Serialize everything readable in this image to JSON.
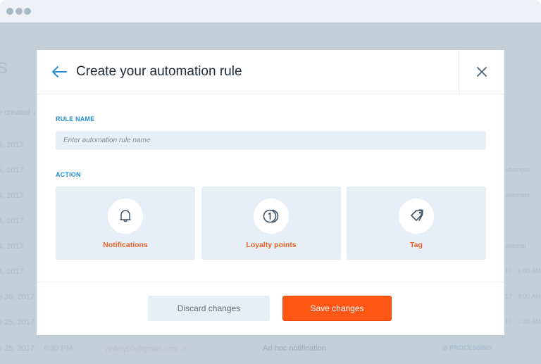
{
  "window": {
    "controls": [
      "close-dot",
      "minimize-dot",
      "maximize-dot"
    ]
  },
  "background": {
    "heading": "S",
    "column_header": "e created  ↓",
    "rows": [
      {
        "date": "5, 2017",
        "right": ""
      },
      {
        "date": "5, 2017",
        "right": "attempts"
      },
      {
        "date": "4, 2017",
        "right": "attempts"
      },
      {
        "date": "4, 2017",
        "right": ""
      },
      {
        "date": "4, 2017",
        "right": "attempt"
      },
      {
        "date": "4, 2017",
        "right": "17  ·  6:00 AM"
      },
      {
        "date": "e 30, 2017",
        "right": "17  ·  9:00 AM"
      },
      {
        "date": "e 25, 2017",
        "right": "17  ·  7:30 AM"
      }
    ],
    "last_row": {
      "date": "e 25, 2017",
      "time": "6:30 PM",
      "email": "anfnly00@gmail.com  ↗",
      "type": "Ad hoc notification",
      "status": "◎ PROCESSING"
    }
  },
  "modal": {
    "title": "Create your automation rule",
    "back_icon": "arrow-left-icon",
    "close_icon": "close-icon",
    "rule_name": {
      "label": "RULE NAME",
      "value": "",
      "placeholder": "Enter automation rule name"
    },
    "action": {
      "label": "ACTION",
      "options": [
        {
          "label": "Notifications",
          "icon": "bell-icon"
        },
        {
          "label": "Loyalty points",
          "icon": "coin-icon"
        },
        {
          "label": "Tag",
          "icon": "tag-icon"
        }
      ]
    },
    "footer": {
      "discard_label": "Discard changes",
      "save_label": "Save changes"
    }
  },
  "colors": {
    "accent_blue": "#1f8fd3",
    "action_orange": "#ea6227",
    "save_button": "#fe5716",
    "card_bg": "#e7eef6",
    "overlay": "#c2cfd9"
  }
}
